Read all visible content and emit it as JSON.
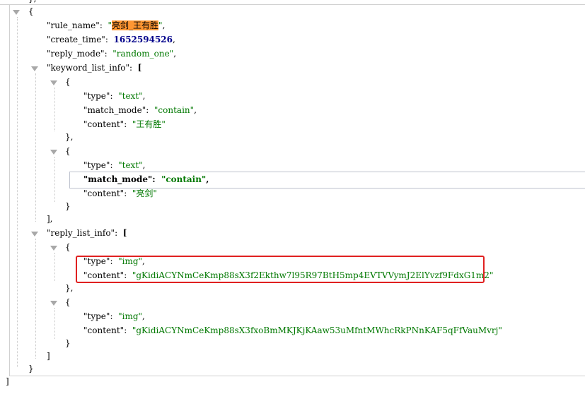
{
  "json": {
    "top_bracket": "},",
    "root_open": "{",
    "root_close": "}",
    "final_close": "]",
    "rule_name": {
      "key": "\"rule_name\"",
      "value": "亮剑_王有胜"
    },
    "create_time": {
      "key": "\"create_time\"",
      "value": "1652594526"
    },
    "reply_mode": {
      "key": "\"reply_mode\"",
      "value": "\"random_one\""
    },
    "keyword_list_info": {
      "key": "\"keyword_list_info\"",
      "open": "[",
      "close": "],",
      "items": [
        {
          "open": "{",
          "close": "},",
          "type": {
            "key": "\"type\"",
            "value": "\"text\""
          },
          "match_mode": {
            "key": "\"match_mode\"",
            "value": "\"contain\""
          },
          "content": {
            "key": "\"content\"",
            "value": "\"王有胜\""
          }
        },
        {
          "open": "{",
          "close": "}",
          "type": {
            "key": "\"type\"",
            "value": "\"text\""
          },
          "match_mode": {
            "key": "\"match_mode\"",
            "value": "\"contain\""
          },
          "content": {
            "key": "\"content\"",
            "value": "\"亮剑\""
          }
        }
      ]
    },
    "reply_list_info": {
      "key": "\"reply_list_info\"",
      "open": "[",
      "close": "]",
      "items": [
        {
          "open": "{",
          "close": "},",
          "type": {
            "key": "\"type\"",
            "value": "\"img\""
          },
          "content": {
            "key": "\"content\"",
            "value": "\"gKidiACYNmCeKmp88sX3f2Ekthw7l95R97BtH5mp4EVTVVymJ2ElYvzf9FdxG1m2\""
          }
        },
        {
          "open": "{",
          "close": "}",
          "type": {
            "key": "\"type\"",
            "value": "\"img\""
          },
          "content": {
            "key": "\"content\"",
            "value": "\"gKidiACYNmCeKmp88sX3fxoBmMKJKjKAaw53uMfntMWhcRkPNnKAF5qFfVauMvrj\""
          }
        }
      ]
    }
  },
  "colors": {
    "string": "#007800",
    "number": "#00008b",
    "highlight": "#ff9632",
    "annotation_box": "#e02020"
  }
}
